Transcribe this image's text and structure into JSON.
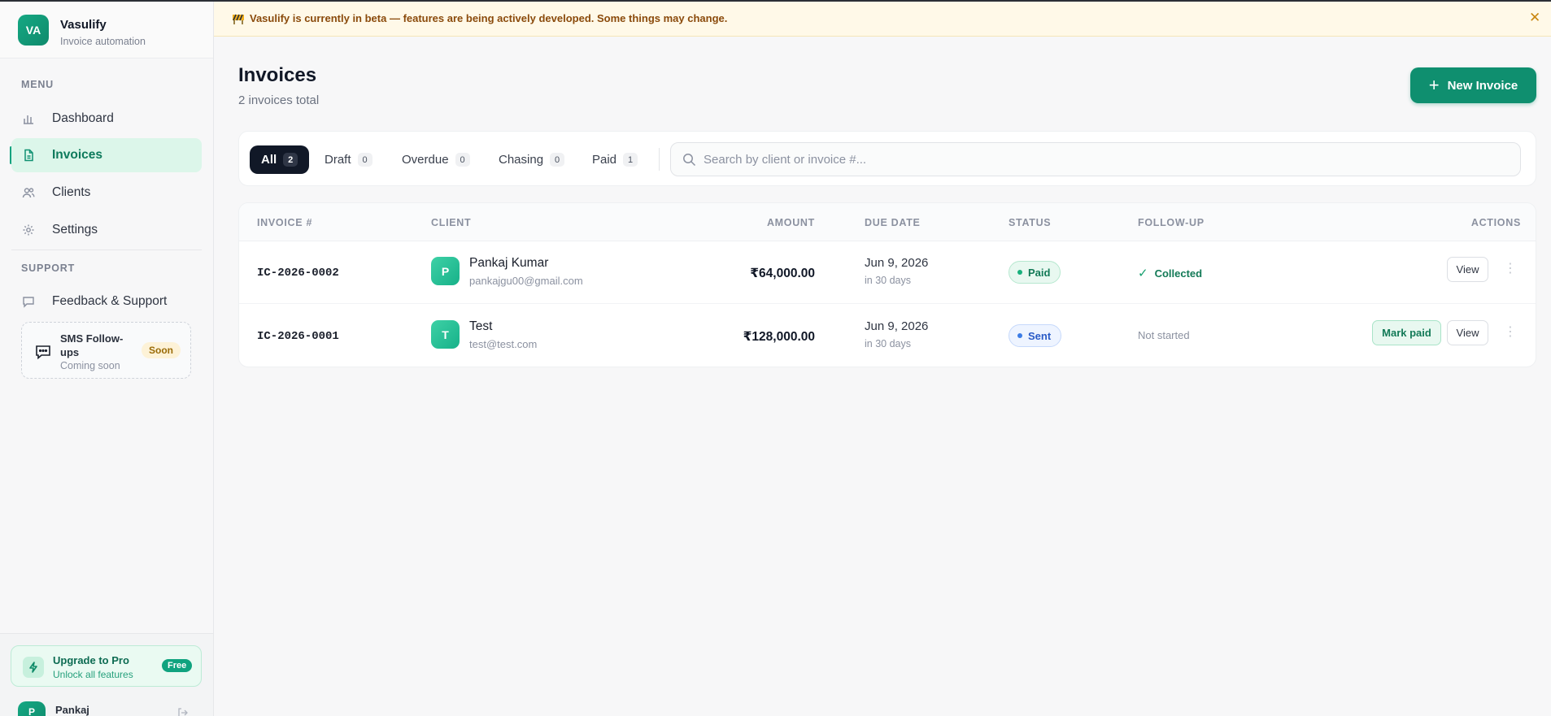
{
  "brand": {
    "logo": "VA",
    "name": "Vasulify",
    "subtitle": "Invoice automation"
  },
  "sidebar": {
    "menu_label": "MENU",
    "items": [
      {
        "label": "Dashboard",
        "icon": "bar-chart-icon"
      },
      {
        "label": "Invoices",
        "icon": "document-icon",
        "active": true
      },
      {
        "label": "Clients",
        "icon": "users-icon"
      },
      {
        "label": "Settings",
        "icon": "gear-icon"
      }
    ],
    "support_label": "SUPPORT",
    "support_items": [
      {
        "label": "Feedback & Support",
        "icon": "message-icon"
      }
    ],
    "soon_card": {
      "title": "SMS Follow-ups",
      "subtitle": "Coming soon",
      "badge": "Soon"
    },
    "upgrade": {
      "title": "Upgrade to Pro",
      "subtitle": "Unlock all features",
      "badge": "Free"
    },
    "user": {
      "initial": "P",
      "name": "Pankaj"
    }
  },
  "banner": {
    "text": "Vasulify is currently in beta — features are being actively developed. Some things may change.",
    "close": "✕"
  },
  "header": {
    "title": "Invoices",
    "subtitle": "2 invoices total",
    "new_button": "New Invoice"
  },
  "filters": {
    "tabs": [
      {
        "label": "All",
        "count": "2",
        "active": true
      },
      {
        "label": "Draft",
        "count": "0"
      },
      {
        "label": "Overdue",
        "count": "0"
      },
      {
        "label": "Chasing",
        "count": "0"
      },
      {
        "label": "Paid",
        "count": "1"
      }
    ],
    "search_placeholder": "Search by client or invoice #..."
  },
  "table": {
    "columns": [
      "INVOICE #",
      "CLIENT",
      "AMOUNT",
      "DUE DATE",
      "STATUS",
      "FOLLOW-UP",
      "ACTIONS"
    ],
    "rows": [
      {
        "invoice": "IC-2026-0002",
        "client_initial": "P",
        "client_name": "Pankaj Kumar",
        "client_email": "pankajgu00@gmail.com",
        "amount": "₹64,000.00",
        "due_date": "Jun 9, 2026",
        "due_sub": "in 30 days",
        "status": "Paid",
        "follow_up": "Collected",
        "actions": [
          "View"
        ]
      },
      {
        "invoice": "IC-2026-0001",
        "client_initial": "T",
        "client_name": "Test",
        "client_email": "test@test.com",
        "amount": "₹128,000.00",
        "due_date": "Jun 9, 2026",
        "due_sub": "in 30 days",
        "status": "Sent",
        "follow_up": "Not started",
        "actions": [
          "Mark paid",
          "View"
        ]
      }
    ]
  },
  "colors": {
    "accent": "#0f8f6f",
    "active_bg": "#dcf6ea",
    "banner_bg": "#fff9e8",
    "dark_tab": "#111827"
  }
}
